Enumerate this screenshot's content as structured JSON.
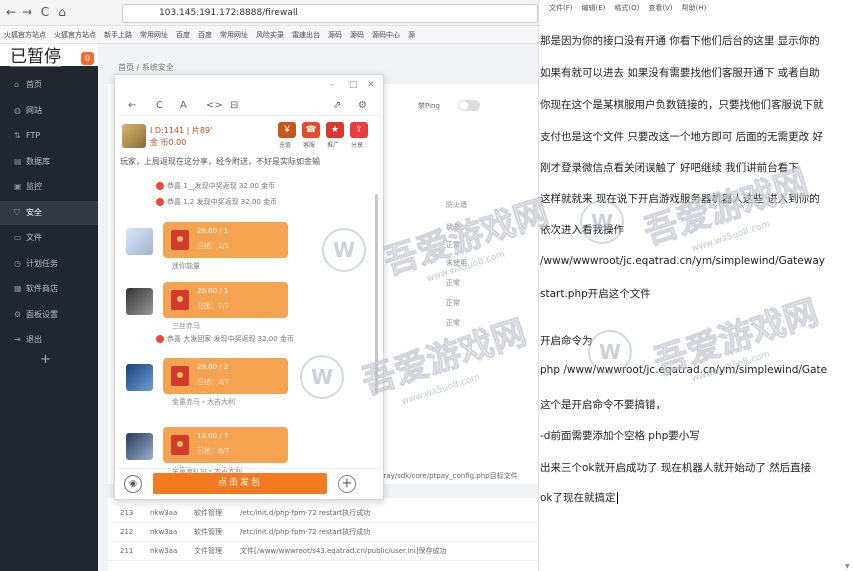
{
  "browser": {
    "nav": [
      "←",
      "→",
      "C",
      "⌂"
    ],
    "url": "103.145.191.172:8888/firewall",
    "bookmarks": [
      "火狐官方站点",
      "火狐官方站点",
      "新手上路",
      "常用网址",
      "百度",
      "百度",
      "常用网址",
      "风险实录",
      "雷速出台",
      "源码",
      "源码",
      "源码中心",
      "源"
    ]
  },
  "overlay": {
    "paused": "已暂停",
    "badge": "0"
  },
  "sidebar": {
    "items": [
      {
        "label": "首页",
        "icon": "home-icon",
        "glyph": "⌂"
      },
      {
        "label": "网站",
        "icon": "globe-icon",
        "glyph": "◍"
      },
      {
        "label": "FTP",
        "icon": "ftp-icon",
        "glyph": "⇅"
      },
      {
        "label": "数据库",
        "icon": "database-icon",
        "glyph": "▤"
      },
      {
        "label": "监控",
        "icon": "monitor-icon",
        "glyph": "▣"
      },
      {
        "label": "安全",
        "icon": "shield-icon",
        "glyph": "⛉"
      },
      {
        "label": "文件",
        "icon": "folder-icon",
        "glyph": "▭"
      },
      {
        "label": "计划任务",
        "icon": "clock-icon",
        "glyph": "◷"
      },
      {
        "label": "软件商店",
        "icon": "store-icon",
        "glyph": "▦"
      },
      {
        "label": "面板设置",
        "icon": "gear-icon",
        "glyph": "⚙"
      },
      {
        "label": "退出",
        "icon": "logout-icon",
        "glyph": "⇥"
      }
    ],
    "add": "+"
  },
  "main": {
    "breadcrumb": "首页 / 系统安全",
    "toggle_label": "禁Ping",
    "col_labels": [
      "防火墙",
      "状态",
      "正常",
      "未使用",
      "正常",
      "正常",
      "正常"
    ],
    "log_fragment": "c/ptray/sdk/core/ptpay_config.php目标文件",
    "table_rows": [
      {
        "id": "213",
        "user": "nkw3aa",
        "type": "软件管理",
        "detail": "/etc/init.d/php-fpm-72 restart执行成功"
      },
      {
        "id": "212",
        "user": "nkw3aa",
        "type": "软件管理",
        "detail": "/etc/init.d/php-fpm-72 restart执行成功"
      },
      {
        "id": "211",
        "user": "nkw3aa",
        "type": "文件管理",
        "detail": "文件[/www/wwwroot/s43.eqatrad.cn/public/user.ini]保存成功"
      }
    ]
  },
  "popup": {
    "toolbar": {
      "back": "←",
      "refresh": "C",
      "font": "A",
      "code": "<>",
      "save": "⊟",
      "share": "⇗",
      "settings": "⚙"
    },
    "win": {
      "min": "–",
      "max": "□",
      "close": "✕"
    },
    "user": {
      "id_line": "I D:1141 | 片89'",
      "coins": "金 币0.00"
    },
    "top_icons": [
      {
        "label": "充值",
        "color": "#c6581e",
        "glyph": "￥"
      },
      {
        "label": "客服",
        "color": "#e54a2a",
        "glyph": "☎"
      },
      {
        "label": "推广",
        "color": "#d9392c",
        "glyph": "★"
      },
      {
        "label": "分享",
        "color": "#ee3b3b",
        "glyph": "⇪"
      }
    ],
    "marquee": "玩家，上局返现在这分享，经今附送，不好是实际如金输",
    "sys_lines": [
      "恭喜 1__发现中奖返现 32.00 金币",
      "恭喜 1.2 发现中奖返现 32.00 金币",
      "恭喜 大发回家 发现中奖返现 32.00 金币"
    ],
    "messages": [
      {
        "line1": "20.00 / 1",
        "line2": "已抢：1/1",
        "sub": "迷你能量"
      },
      {
        "line1": "20.00 / 1",
        "line2": "已抢：7/7",
        "sub": "三丝赤马"
      },
      {
        "line1": "20.00 / 2",
        "line2": "已抢：3/7",
        "sub": "金童赤马・大吉大利"
      },
      {
        "line1": "10.00 / 7",
        "line2": "已抢：8/7",
        "sub": "金童发红包・大吉大利"
      }
    ],
    "footer": {
      "voice": "◉",
      "send": "点击发包",
      "plus": "+"
    }
  },
  "doc": {
    "menu": [
      "文件(F)",
      "编辑(E)",
      "格式(O)",
      "查看(V)",
      "帮助(H)"
    ],
    "lines": [
      "那是因为你的接口没有开通   你看下他们后台的这里 显示你的",
      "如果有就可以进去  如果没有需要找他们客服开通下 或者自助",
      "你现在这个是某棋服用户负数链接的，只要找他们客服说下就",
      "支付也是这个文件 只要改这一个地方即可 后面的无需更改  好",
      "刚才登录微信点看关闭误触了  好吧继续  我们讲前台看下",
      "这样就就来 现在说下开启游戏服务器机器人这些  进入到你的",
      "依次进入看我操作",
      "/www/wwwroot/jc.eqatrad.cn/ym/simplewind/Gateway",
      "start.php开启这个文件",
      "",
      "开启命令为",
      "php /www/wwwroot/jc.eqatrad.cn/ym/simplewind/Gate",
      "这个是开启命令不要搞错，",
      "-d前面需要添加个空格   php要小写",
      "出来三个ok就开启成功了    现在机器人就开始动了  然后直接",
      "ok了现在就搞定"
    ]
  },
  "watermark": {
    "text": "吾爱游戏网",
    "sub": "www.wa5uo8.com",
    "logo": "W"
  }
}
